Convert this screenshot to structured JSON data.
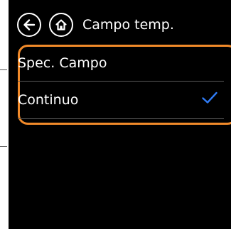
{
  "header": {
    "title": "Campo temp.",
    "back_icon": "back-arrow-circle-icon",
    "home_icon": "home-circle-icon"
  },
  "options": [
    {
      "label": "Spec. Campo",
      "selected": false
    },
    {
      "label": "Continuo",
      "selected": true
    }
  ],
  "colors": {
    "screen_background": "#000000",
    "highlight_border": "#f18a2a",
    "check_color": "#2f7bf5",
    "divider": "#5a5a5a"
  }
}
